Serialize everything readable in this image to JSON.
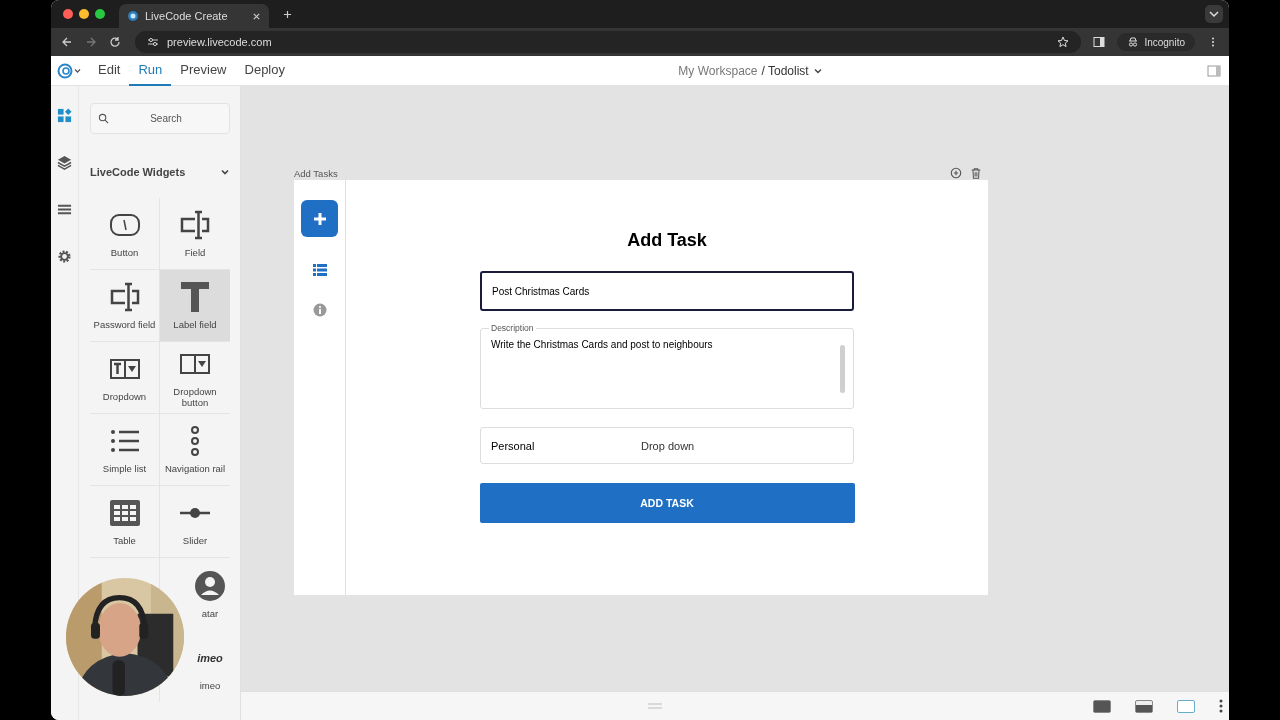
{
  "browser": {
    "tab_title": "LiveCode Create",
    "url": "preview.livecode.com",
    "profile": "Incognito"
  },
  "app_menu": [
    {
      "label": "Edit",
      "selected": false
    },
    {
      "label": "Run",
      "selected": true
    },
    {
      "label": "Preview",
      "selected": false
    },
    {
      "label": "Deploy",
      "selected": false
    }
  ],
  "breadcrumb": {
    "workspace": "My Workspace",
    "project": "/ Todolist"
  },
  "sidebar": {
    "search": {
      "placeholder": "Search"
    },
    "section_title": "LiveCode Widgets",
    "expanded": true,
    "widgets": [
      {
        "kind": "button",
        "label": "Button",
        "selected": false
      },
      {
        "kind": "field",
        "label": "Field",
        "selected": false
      },
      {
        "kind": "password",
        "label": "Password field",
        "selected": false
      },
      {
        "kind": "label",
        "label": "Label field",
        "selected": true
      },
      {
        "kind": "dropdown",
        "label": "Dropdown",
        "selected": false
      },
      {
        "kind": "dropdown-button",
        "label": "Dropdown button",
        "selected": false
      },
      {
        "kind": "list",
        "label": "Simple list",
        "selected": false
      },
      {
        "kind": "nav-rail",
        "label": "Navigation rail",
        "selected": false
      },
      {
        "kind": "table",
        "label": "Table",
        "selected": false
      },
      {
        "kind": "slider",
        "label": "Slider",
        "selected": false
      },
      {
        "kind": "avatar",
        "label": "atar",
        "selected": false
      },
      {
        "kind": "logo",
        "logo_text": "imeo",
        "label": "imeo",
        "selected": false
      }
    ]
  },
  "canvas": {
    "card_title": "Add Tasks",
    "rail": [
      {
        "kind": "add"
      },
      {
        "kind": "list"
      },
      {
        "kind": "info"
      }
    ],
    "heading": "Add Task",
    "title_field": {
      "value": "Post Christmas Cards",
      "focused": true
    },
    "description": {
      "label": "Description",
      "value": "Write the Christmas Cards and post to neighbours"
    },
    "dropdown": {
      "value": "Personal",
      "hint": "Drop down"
    },
    "submit": "ADD TASK"
  },
  "layout_buttons": [
    {
      "kind": "full",
      "selected": false
    },
    {
      "kind": "bottom",
      "selected": false
    },
    {
      "kind": "empty",
      "selected": true
    }
  ]
}
